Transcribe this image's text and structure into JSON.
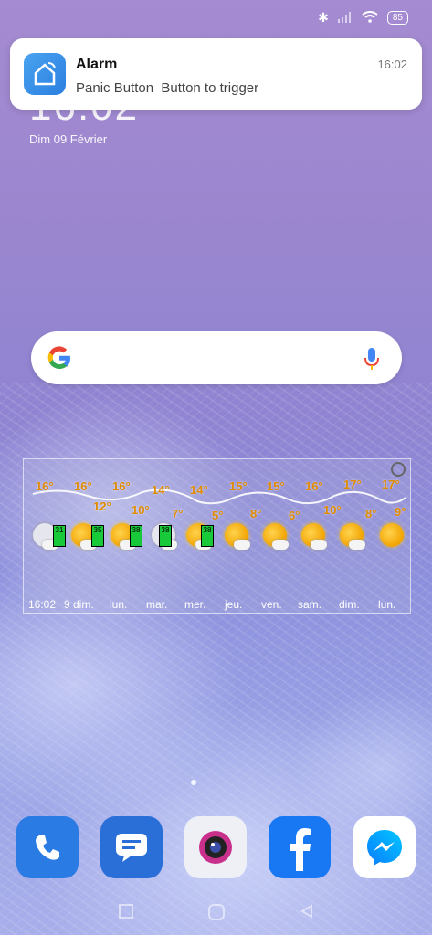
{
  "status_bar": {
    "battery": "85"
  },
  "background": {
    "clock": "16:02",
    "date": "Dim 09 Février"
  },
  "notification": {
    "title": "Alarm",
    "body": "Panic Button  Button to trigger",
    "time": "16:02",
    "icon": "smart-home-icon"
  },
  "search": {
    "logo": "google-icon",
    "mic": "microphone-icon"
  },
  "weather": {
    "highs": [
      "16°",
      "16°",
      "16°",
      "14°",
      "14°",
      "15°",
      "15°",
      "16°",
      "17°",
      "17°"
    ],
    "lows": [
      "12°",
      "10°",
      "7°",
      "5°",
      "8°",
      "6°",
      "10°",
      "8°",
      "9°"
    ],
    "days": [
      "16:02",
      "9 dim.",
      "lun.",
      "mar.",
      "mer.",
      "jeu.",
      "ven.",
      "sam.",
      "dim.",
      "lun."
    ],
    "badges": [
      "31",
      "35",
      "38",
      "38",
      "38",
      "38"
    ],
    "badge_color": "#18c93a",
    "temp_color": "#e08a00"
  },
  "dock": [
    {
      "name": "Phone",
      "color": "#2a7be4"
    },
    {
      "name": "Messages",
      "color": "#2a6fd8"
    },
    {
      "name": "Camera",
      "color": "#f0f0f5"
    },
    {
      "name": "Facebook",
      "color": "#1877f2"
    },
    {
      "name": "Messenger",
      "color": "#ffffff"
    }
  ]
}
